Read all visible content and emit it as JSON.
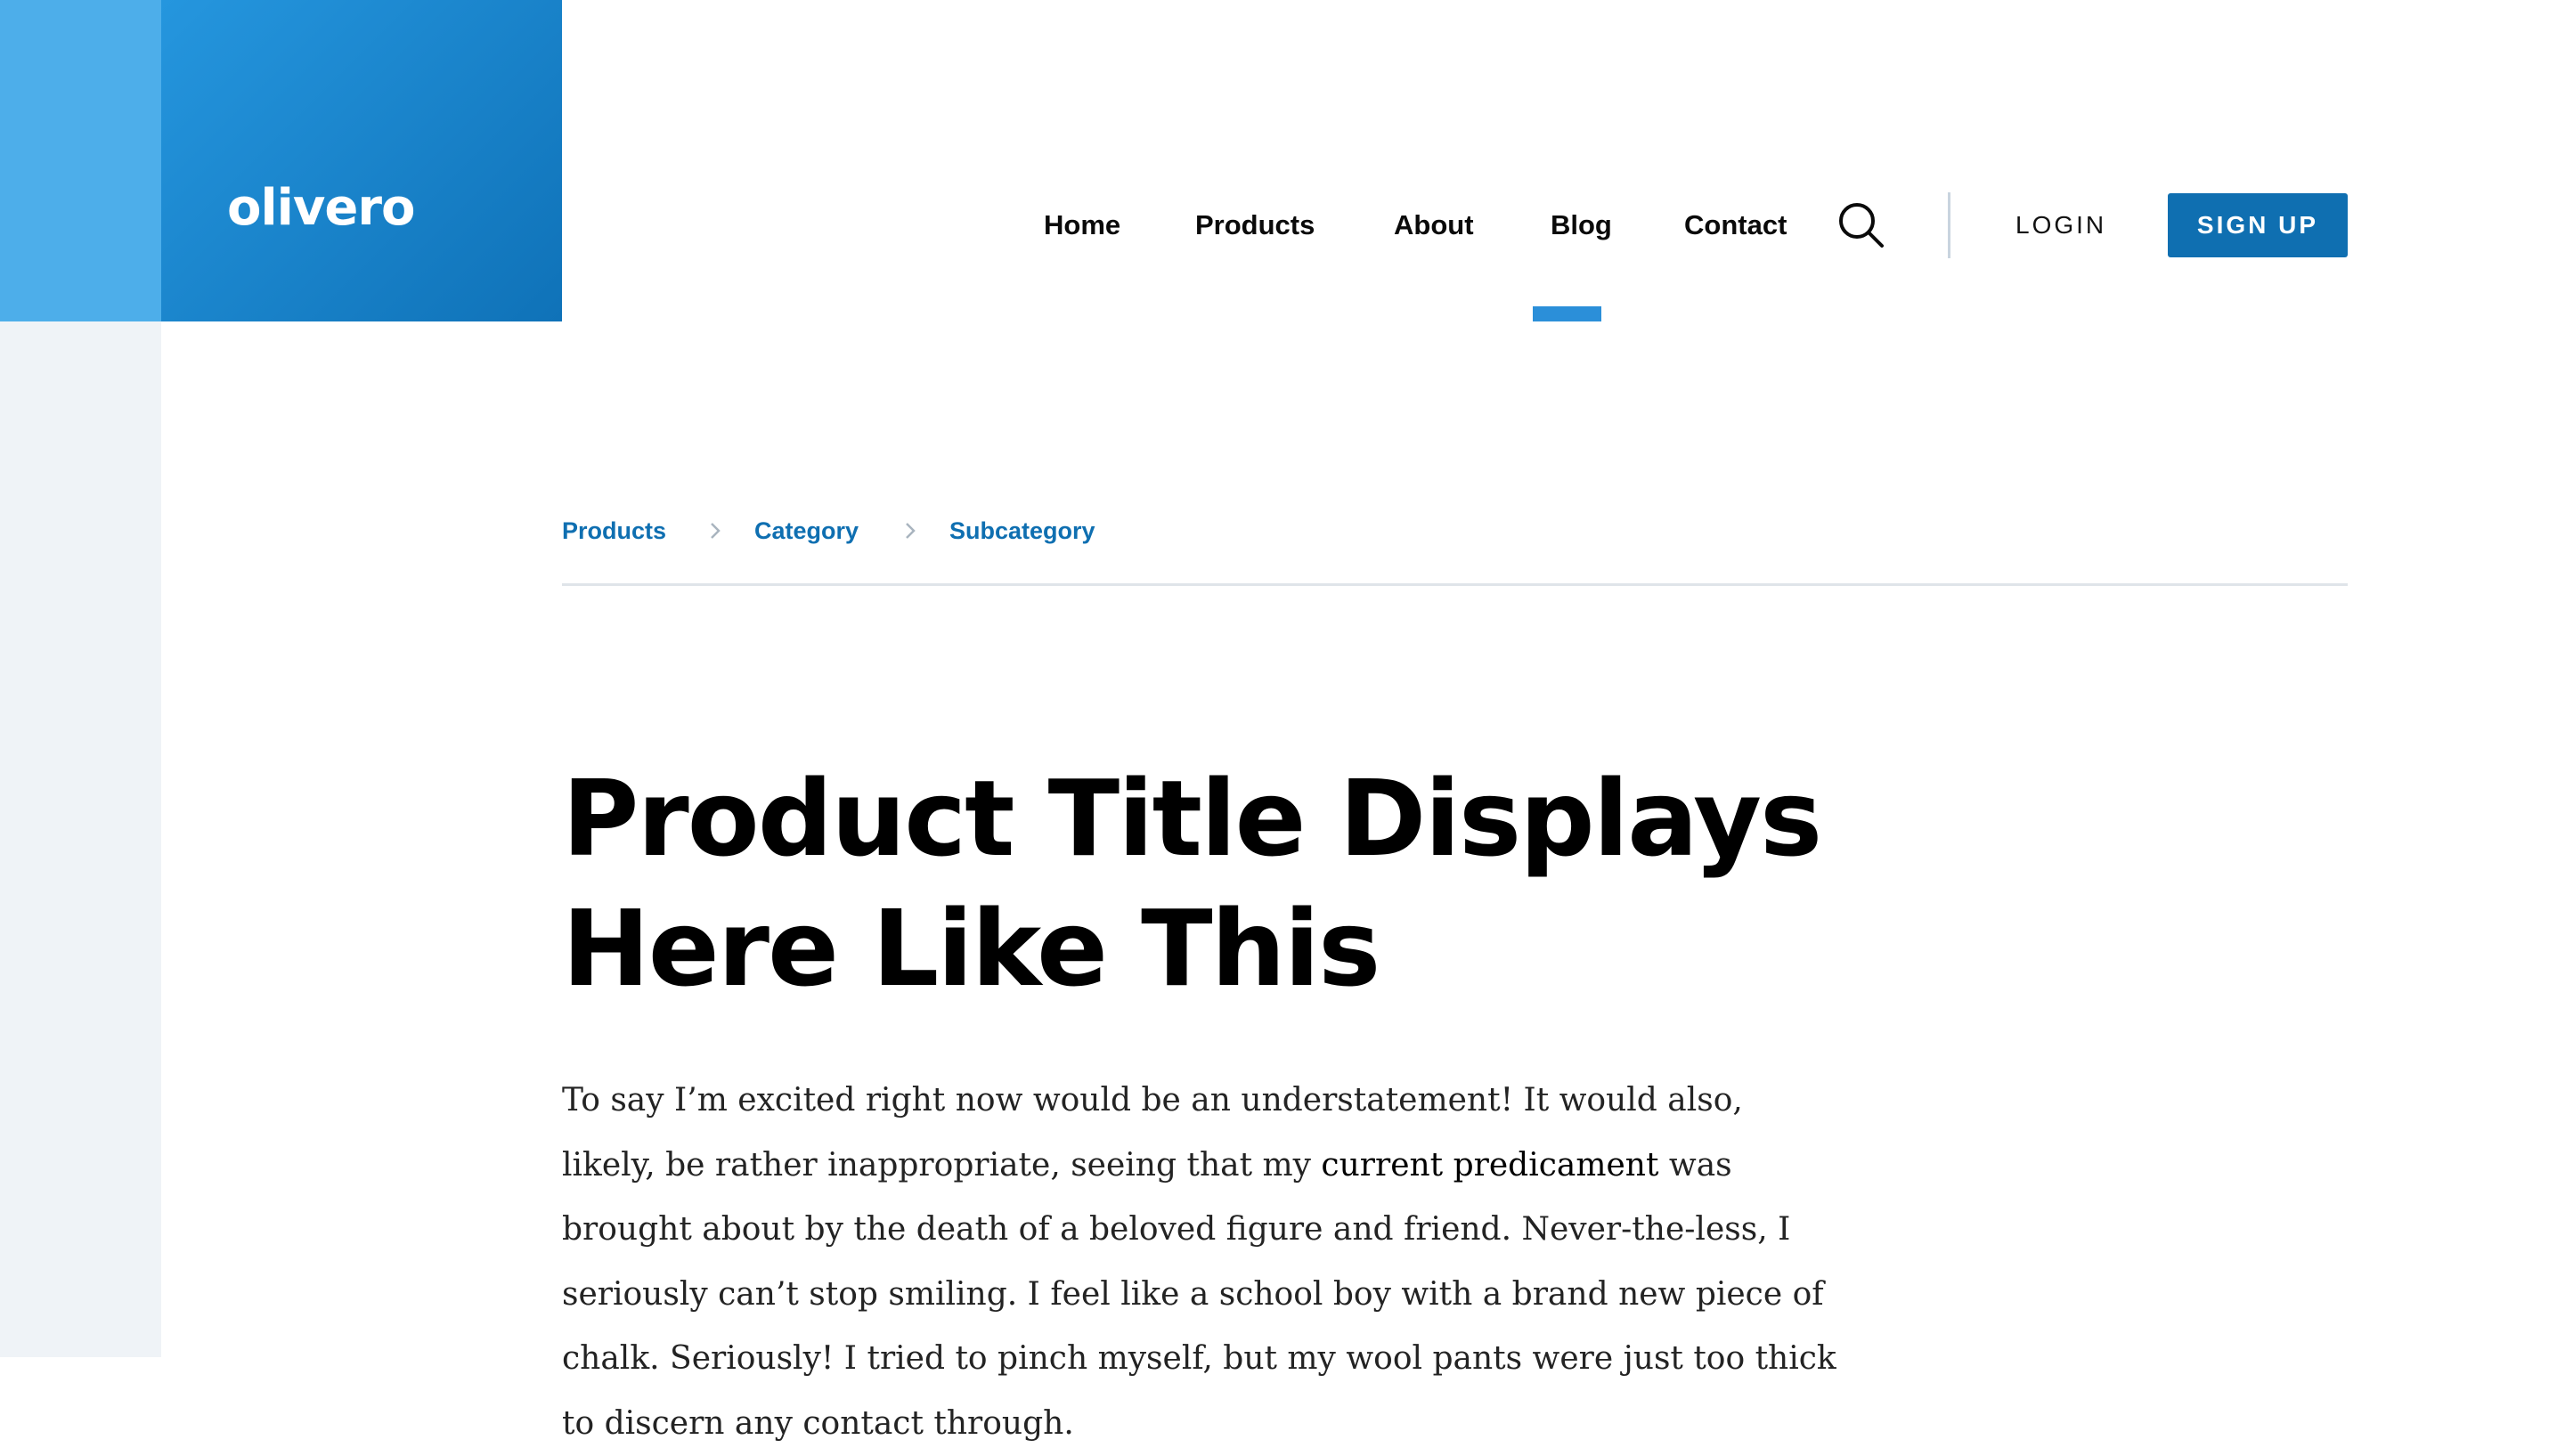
{
  "brand": {
    "logo_text": "olivero",
    "primary_color": "#0f6fb1",
    "accent_color": "#2b8fd9"
  },
  "nav": {
    "items": [
      {
        "label": "Home"
      },
      {
        "label": "Products"
      },
      {
        "label": "About"
      },
      {
        "label": "Blog",
        "active": true
      },
      {
        "label": "Contact"
      }
    ],
    "search_icon": "search-icon",
    "login_label": "LOGIN",
    "signup_label": "SIGN UP"
  },
  "breadcrumb": {
    "items": [
      {
        "label": "Products"
      },
      {
        "label": "Category"
      },
      {
        "label": "Subcategory"
      }
    ],
    "separator_icon": "chevron-right-icon"
  },
  "article": {
    "title_line1": "Product Title Displays",
    "title_line2": "Here Like This",
    "body_part1": "To say I’m excited right now would be an understatement! It would also, likely, be rather inappropriate, seeing that my ",
    "body_link": "current predicament",
    "body_part2": " was brought about by the death of a beloved figure and friend. Never-the-less, I seriously can’t stop smiling. I feel like a school boy with a brand new piece of chalk. Seriously! I tried to pinch myself, but my wool pants were just too thick to discern any contact through."
  }
}
